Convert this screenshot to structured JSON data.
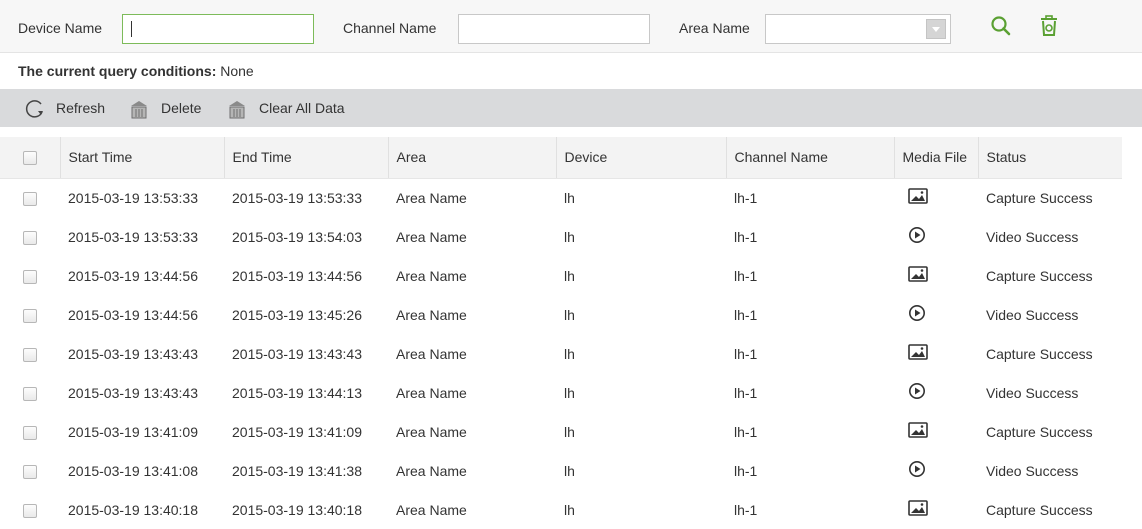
{
  "filters": {
    "device_name_label": "Device Name",
    "device_name_value": "",
    "channel_name_label": "Channel Name",
    "channel_name_value": "",
    "area_name_label": "Area Name",
    "area_name_value": "",
    "search_icon": "search-icon",
    "clear_icon": "trash-icon"
  },
  "query": {
    "label": "The current query conditions:",
    "value": "None"
  },
  "toolbar": {
    "refresh": "Refresh",
    "delete": "Delete",
    "clear_all": "Clear All Data"
  },
  "table": {
    "headers": [
      "Start Time",
      "End Time",
      "Area",
      "Device",
      "Channel Name",
      "Media File",
      "Status"
    ],
    "rows": [
      {
        "start": "2015-03-19 13:53:33",
        "end": "2015-03-19 13:53:33",
        "area": "Area Name",
        "device": "lh",
        "channel": "lh-1",
        "media": "image",
        "status": "Capture Success"
      },
      {
        "start": "2015-03-19 13:53:33",
        "end": "2015-03-19 13:54:03",
        "area": "Area Name",
        "device": "lh",
        "channel": "lh-1",
        "media": "video",
        "status": "Video Success"
      },
      {
        "start": "2015-03-19 13:44:56",
        "end": "2015-03-19 13:44:56",
        "area": "Area Name",
        "device": "lh",
        "channel": "lh-1",
        "media": "image",
        "status": "Capture Success"
      },
      {
        "start": "2015-03-19 13:44:56",
        "end": "2015-03-19 13:45:26",
        "area": "Area Name",
        "device": "lh",
        "channel": "lh-1",
        "media": "video",
        "status": "Video Success"
      },
      {
        "start": "2015-03-19 13:43:43",
        "end": "2015-03-19 13:43:43",
        "area": "Area Name",
        "device": "lh",
        "channel": "lh-1",
        "media": "image",
        "status": "Capture Success"
      },
      {
        "start": "2015-03-19 13:43:43",
        "end": "2015-03-19 13:44:13",
        "area": "Area Name",
        "device": "lh",
        "channel": "lh-1",
        "media": "video",
        "status": "Video Success"
      },
      {
        "start": "2015-03-19 13:41:09",
        "end": "2015-03-19 13:41:09",
        "area": "Area Name",
        "device": "lh",
        "channel": "lh-1",
        "media": "image",
        "status": "Capture Success"
      },
      {
        "start": "2015-03-19 13:41:08",
        "end": "2015-03-19 13:41:38",
        "area": "Area Name",
        "device": "lh",
        "channel": "lh-1",
        "media": "video",
        "status": "Video Success"
      },
      {
        "start": "2015-03-19 13:40:18",
        "end": "2015-03-19 13:40:18",
        "area": "Area Name",
        "device": "lh",
        "channel": "lh-1",
        "media": "image",
        "status": "Capture Success"
      }
    ]
  },
  "colors": {
    "accent_green": "#5aa032",
    "toolbar_bg": "#d9dadc"
  }
}
